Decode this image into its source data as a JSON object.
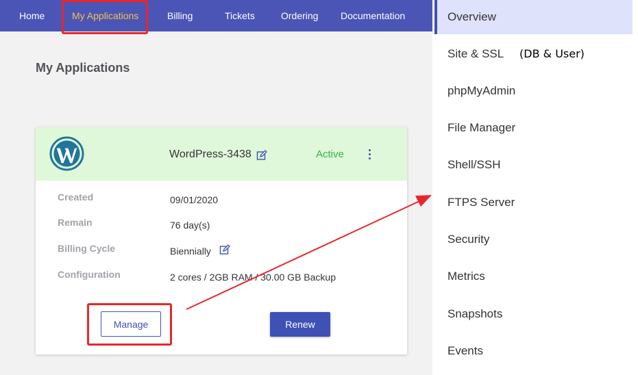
{
  "nav": {
    "items": [
      "Home",
      "My Applications",
      "Billing",
      "Tickets",
      "Ordering",
      "Documentation"
    ]
  },
  "page": {
    "title": "My Applications"
  },
  "app_card": {
    "name": "WordPress-3438",
    "status": "Active",
    "rows": [
      {
        "label": "Created",
        "value": "09/01/2020"
      },
      {
        "label": "Remain",
        "value": "76 day(s)"
      },
      {
        "label": "Billing Cycle",
        "value": "Biennially"
      },
      {
        "label": "Configuration",
        "value": "2 cores / 2GB RAM / 30.00 GB Backup"
      }
    ],
    "manage_label": "Manage",
    "renew_label": "Renew"
  },
  "side_menu": {
    "items": [
      "Overview",
      "Site & SSL",
      "phpMyAdmin",
      "File Manager",
      "Shell/SSH",
      "FTPS Server",
      "Security",
      "Metrics",
      "Snapshots",
      "Events"
    ],
    "note": "(DB & User)"
  },
  "colors": {
    "nav_bg": "#4b55b5",
    "active_nav": "#f2c14e",
    "highlight": "#e8262a",
    "status_green": "#36b24a",
    "primary": "#3f51b5"
  }
}
